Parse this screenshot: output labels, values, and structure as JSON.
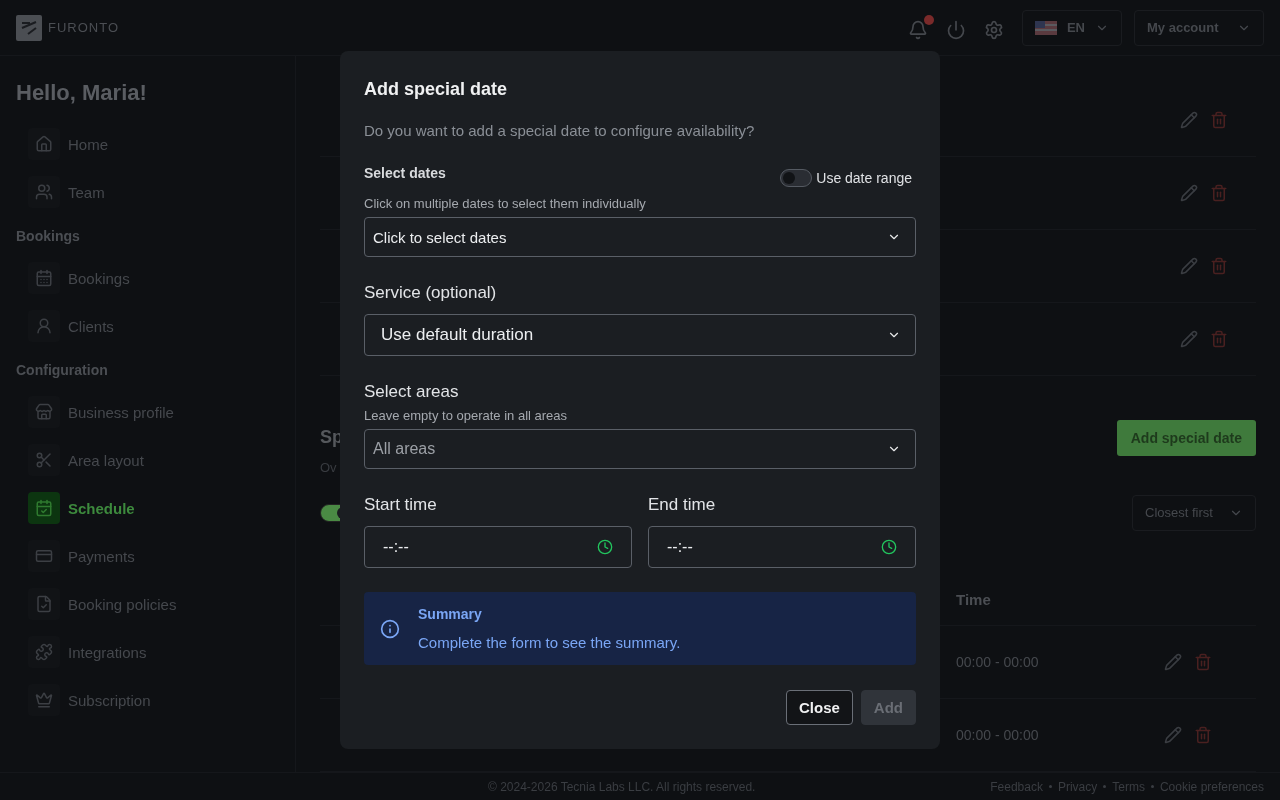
{
  "header": {
    "logo": "FURONTO",
    "notification_badge": true,
    "language": "EN",
    "account": "My account"
  },
  "sidebar": {
    "greeting": "Hello, Maria!",
    "sections": [
      {
        "items": [
          {
            "label": "Home",
            "selected": false
          },
          {
            "label": "Team",
            "selected": false
          }
        ]
      },
      {
        "title": "Bookings",
        "items": [
          {
            "label": "Bookings",
            "selected": false
          },
          {
            "label": "Clients",
            "selected": false
          }
        ]
      },
      {
        "title": "Configuration",
        "items": [
          {
            "label": "Business profile",
            "selected": false
          },
          {
            "label": "Area layout",
            "selected": false
          },
          {
            "label": "Schedule",
            "selected": true
          },
          {
            "label": "Payments",
            "selected": false
          },
          {
            "label": "Booking policies",
            "selected": false
          },
          {
            "label": "Integrations",
            "selected": false
          },
          {
            "label": "Subscription",
            "selected": false
          }
        ]
      }
    ]
  },
  "main": {
    "section_title": "Sp",
    "section_subtitle": "Ov",
    "add_button": "Add special date",
    "past_toggle": {
      "on": true
    },
    "sort": "Closest first",
    "table": {
      "column": "Time",
      "rows": [
        {
          "time": "00:00 - 00:00"
        },
        {
          "time": "00:00 - 00:00"
        }
      ]
    }
  },
  "dialog": {
    "title": "Add special date",
    "description": "Do you want to add a special date to configure availability?",
    "dates": {
      "label": "Select dates",
      "range_toggle": {
        "label": "Use date range",
        "on": false
      },
      "hint": "Click on multiple dates to select them individually",
      "picker": "Click to select dates"
    },
    "service": {
      "label": "Service (optional)",
      "value": "Use default duration"
    },
    "areas": {
      "label": "Select areas",
      "hint": "Leave empty to operate in all areas",
      "placeholder": "All areas"
    },
    "start_time": {
      "label": "Start time",
      "value": "--:--"
    },
    "end_time": {
      "label": "End time",
      "value": "--:--"
    },
    "summary": {
      "title": "Summary",
      "text": "Complete the form to see the summary."
    },
    "buttons": [
      {
        "label": "Close",
        "disabled": false
      },
      {
        "label": "Add",
        "disabled": true
      }
    ]
  },
  "footer": {
    "copyright": "© 2024-2026 Tecnia Labs LLC. All rights reserved.",
    "links": [
      "Feedback",
      "Privacy",
      "Terms",
      "Cookie preferences"
    ]
  }
}
